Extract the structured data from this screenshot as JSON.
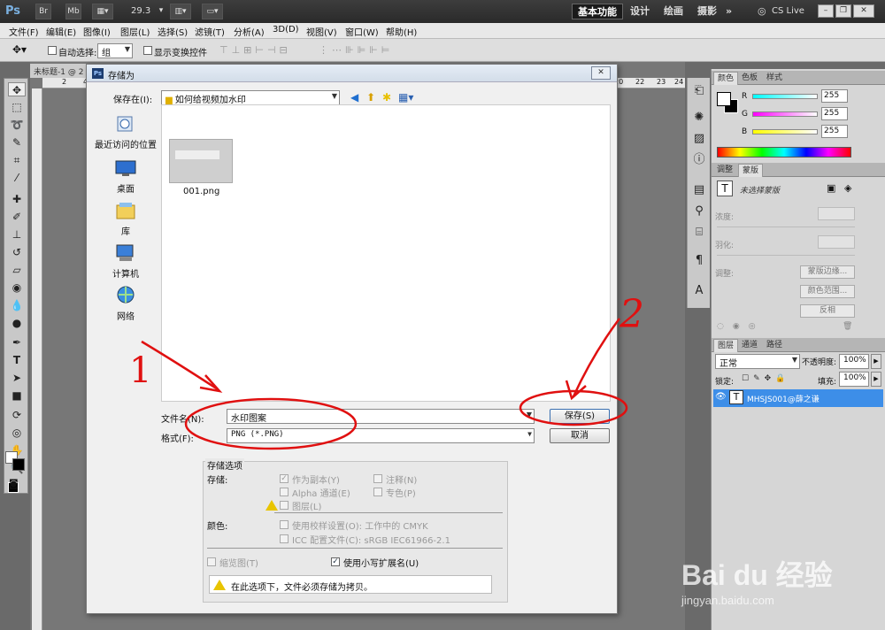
{
  "appbar": {
    "logo": "Ps",
    "buttons": [
      "Br",
      "Mb"
    ],
    "zoom": "29.3",
    "workspaces": [
      "基本功能",
      "设计",
      "绘画",
      "摄影",
      "»"
    ],
    "cslive": "CS Live"
  },
  "menubar": {
    "items": [
      "文件(F)",
      "编辑(E)",
      "图像(I)",
      "图层(L)",
      "选择(S)",
      "滤镜(T)",
      "分析(A)",
      "3D(D)",
      "视图(V)",
      "窗口(W)",
      "帮助(H)"
    ]
  },
  "optbar": {
    "auto_select": "自动选择:",
    "group_value": "组",
    "show_transform": "显示变换控件"
  },
  "document": {
    "tab_title": "未标题-1 @ 2",
    "ruler_ticks": [
      "2",
      "4",
      "20",
      "22",
      "23",
      "24"
    ]
  },
  "panels": {
    "color_tabs": [
      "颜色",
      "色板",
      "样式"
    ],
    "rgb": [
      {
        "label": "R",
        "value": "255"
      },
      {
        "label": "G",
        "value": "255"
      },
      {
        "label": "B",
        "value": "255"
      }
    ],
    "adjust_tabs": [
      "调整",
      "蒙版"
    ],
    "mask_status": "未选择蒙版",
    "mask_rows": [
      "浓度:",
      "羽化:",
      "调整:"
    ],
    "mask_buttons": [
      "蒙版边缘...",
      "颜色范围...",
      "反相"
    ],
    "layer_tabs": [
      "图层",
      "通道",
      "路径"
    ],
    "blend_mode": "正常",
    "opacity_label": "不透明度:",
    "opacity_value": "100%",
    "lock_label": "锁定:",
    "fill_label": "填充:",
    "fill_value": "100%",
    "layer_name": "MHSJS001@薛之谦"
  },
  "dialog": {
    "title": "存储为",
    "save_in_label": "保存在(I):",
    "save_in_value": "如何给视频加水印",
    "places": [
      "最近访问的位置",
      "桌面",
      "库",
      "计算机",
      "网络"
    ],
    "files": [
      {
        "name": "001.png"
      }
    ],
    "filename_label": "文件名(N):",
    "filename_value": "水印图案",
    "format_label": "格式(F):",
    "format_value": "PNG (*.PNG)",
    "save_button": "保存(S)",
    "cancel_button": "取消",
    "options": {
      "title": "存储选项",
      "save_label": "存储:",
      "as_copy": "作为副本(Y)",
      "notes": "注释(N)",
      "alpha": "Alpha 通道(E)",
      "spot": "专色(P)",
      "layers": "图层(L)",
      "color_label": "颜色:",
      "use_proof": "使用校样设置(O): 工作中的 CMYK",
      "icc": "ICC 配置文件(C): sRGB IEC61966-2.1",
      "thumbnail": "缩览图(T)",
      "lowercase": "使用小写扩展名(U)",
      "warning": "在此选项下，文件必须存储为拷贝。"
    }
  },
  "annotations": [
    "1",
    "2"
  ],
  "watermark": {
    "brand": "Bai du 经验",
    "url": "jingyan.baidu.com"
  }
}
